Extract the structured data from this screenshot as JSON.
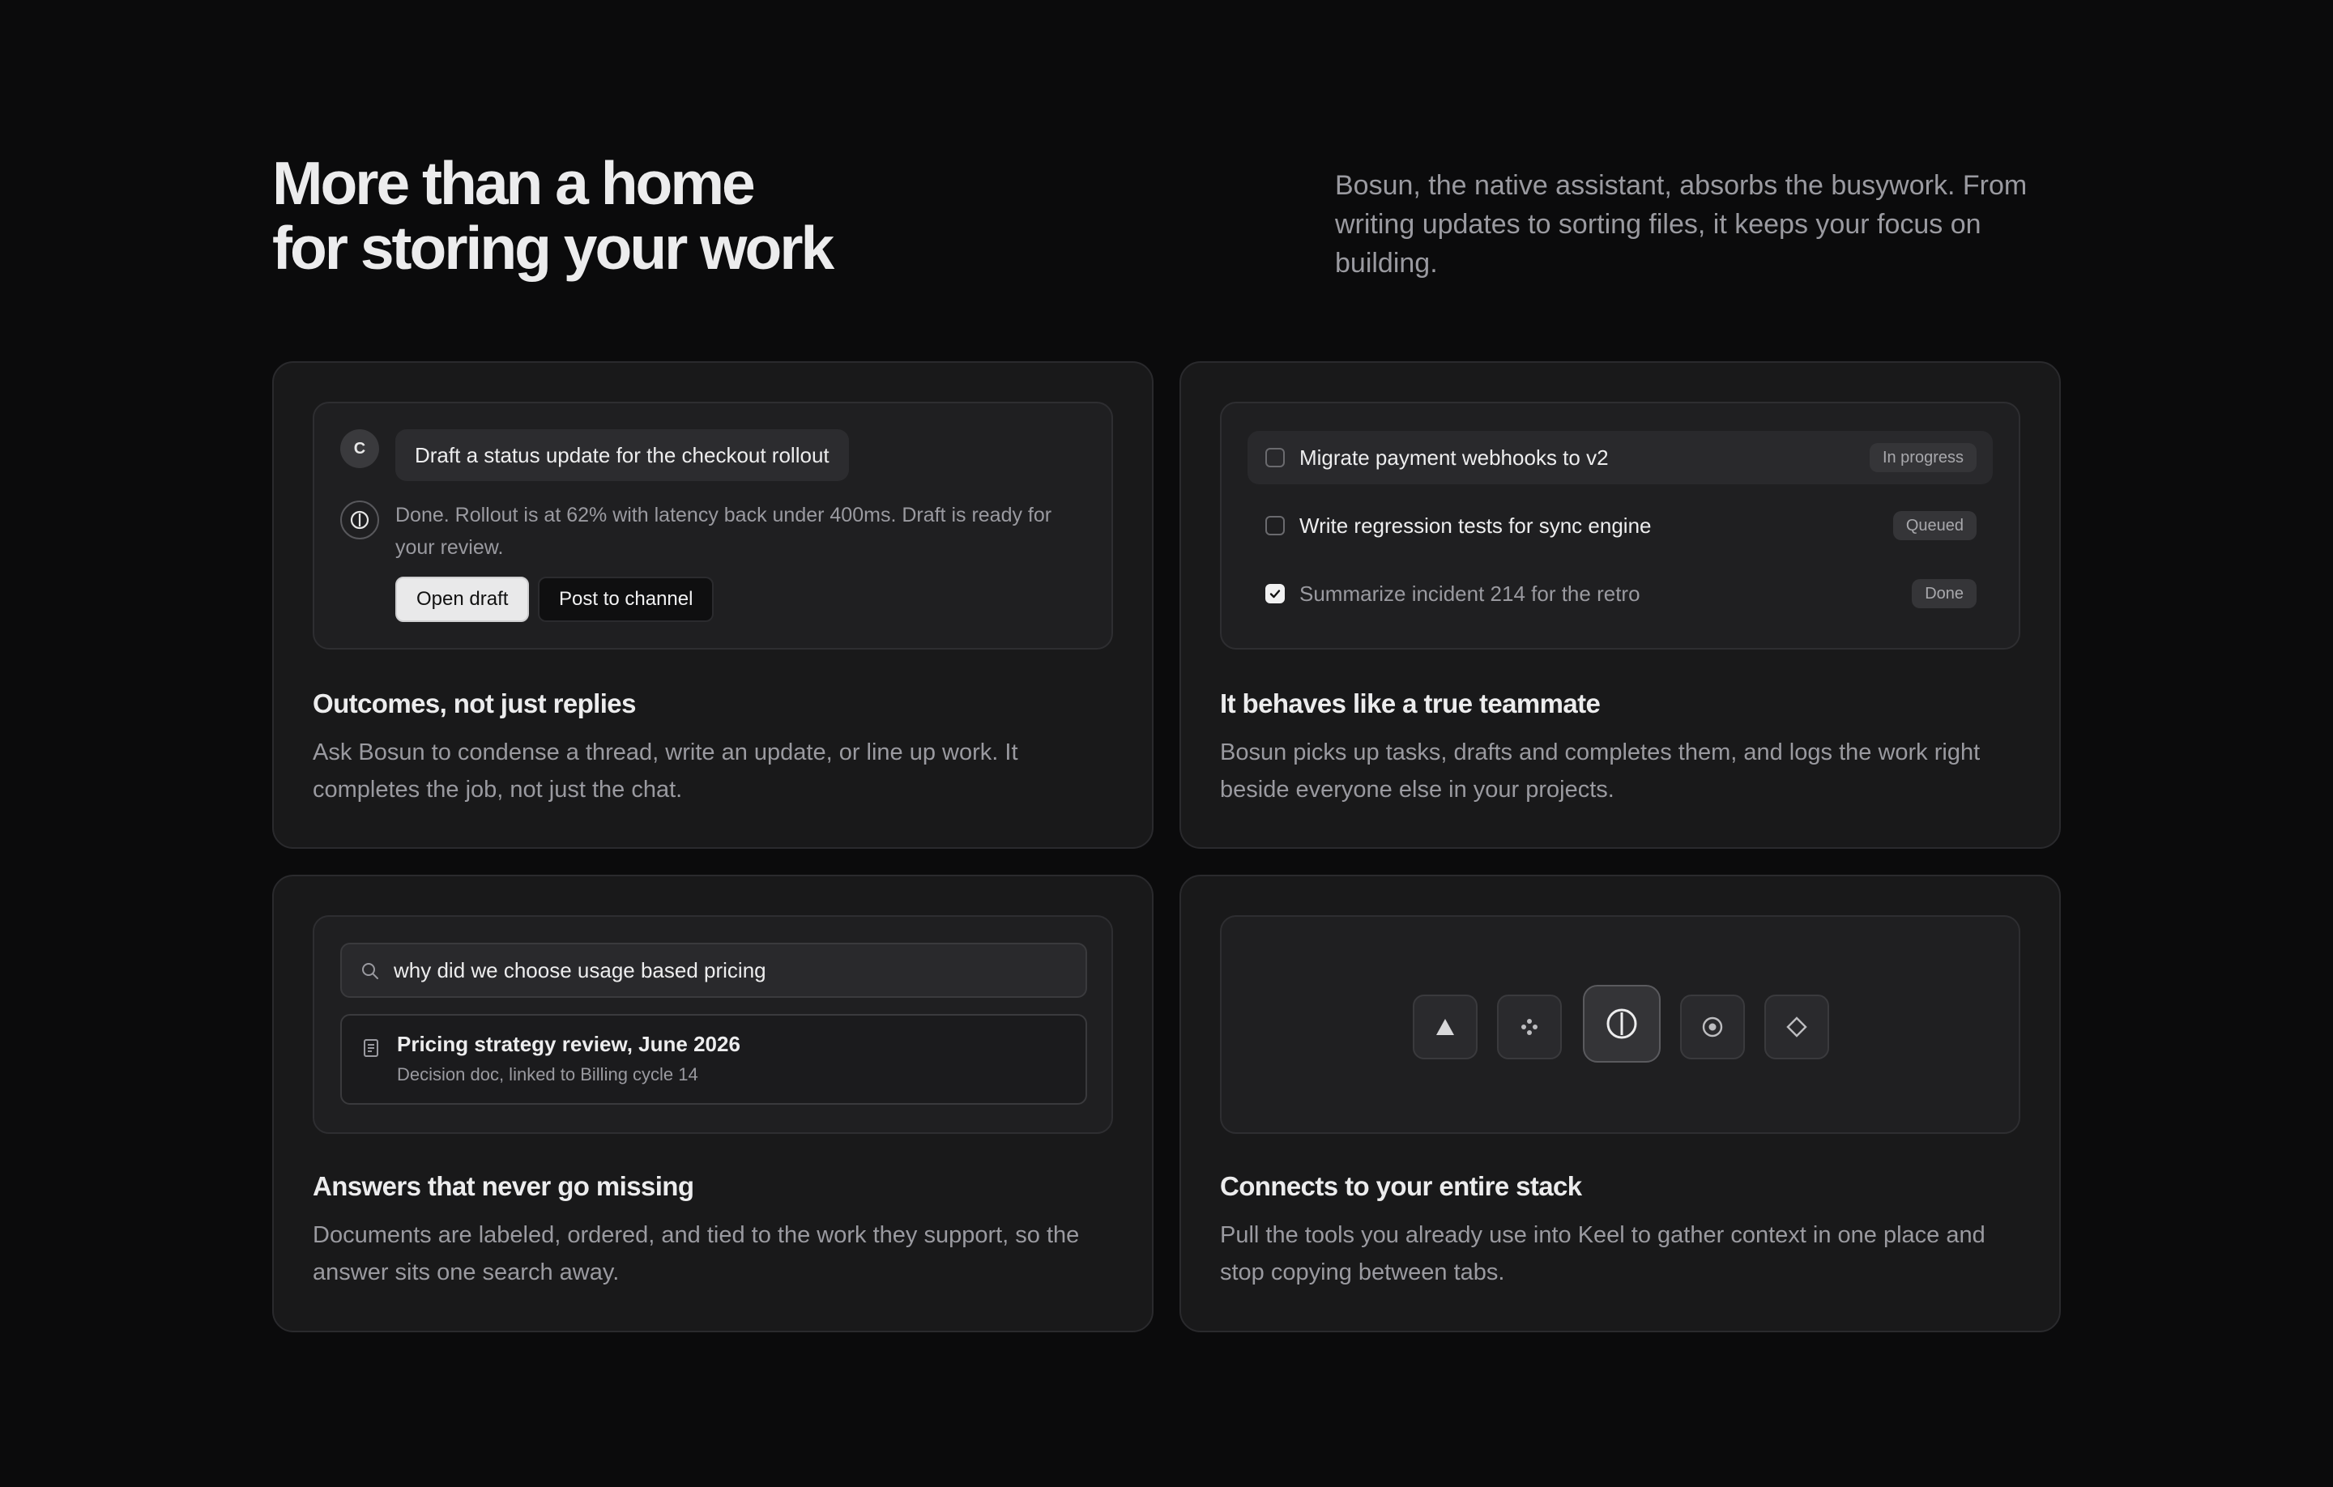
{
  "hero": {
    "title_line1": "More than a home",
    "title_line2": "for storing your work",
    "description": "Bosun, the native assistant, absorbs the busywork. From writing updates to sorting files, it keeps your focus on building."
  },
  "cards": {
    "outcomes": {
      "title": "Outcomes, not just replies",
      "description": "Ask Bosun to condense a thread, write an update, or line up work. It completes the job, not just the chat.",
      "chat": {
        "avatar_initial": "C",
        "user_message": "Draft a status update for the checkout rollout",
        "bot_reply": "Done. Rollout is at 62% with latency back under 400ms. Draft is ready for your review.",
        "primary_action": "Open draft",
        "secondary_action": "Post to channel"
      }
    },
    "teammate": {
      "title": "It behaves like a true teammate",
      "description": "Bosun picks up tasks, drafts and completes them, and logs the work right beside everyone else in your projects.",
      "tasks": [
        {
          "label": "Migrate payment webhooks to v2",
          "status": "In progress",
          "checked": false
        },
        {
          "label": "Write regression tests for sync engine",
          "status": "Queued",
          "checked": false
        },
        {
          "label": "Summarize incident 214 for the retro",
          "status": "Done",
          "checked": true
        }
      ]
    },
    "answers": {
      "title": "Answers that never go missing",
      "description": "Documents are labeled, ordered, and tied to the work they support, so the answer sits one search away.",
      "search_query": "why did we choose usage based pricing",
      "result": {
        "title": "Pricing strategy review, June 2026",
        "subtitle": "Decision doc, linked to Billing cycle 14"
      }
    },
    "stack": {
      "title": "Connects to your entire stack",
      "description": "Pull the tools you already use into Keel to gather context in one place and stop copying between tabs.",
      "integrations": [
        "triangle-icon",
        "dots-icon",
        "bosun-logo-icon",
        "target-icon",
        "diamond-icon"
      ]
    }
  },
  "colors": {
    "background": "#0b0b0c",
    "card": "#19191a",
    "panel": "#1f1f21",
    "text_primary": "#ededee",
    "text_muted": "#9a9aa0"
  }
}
